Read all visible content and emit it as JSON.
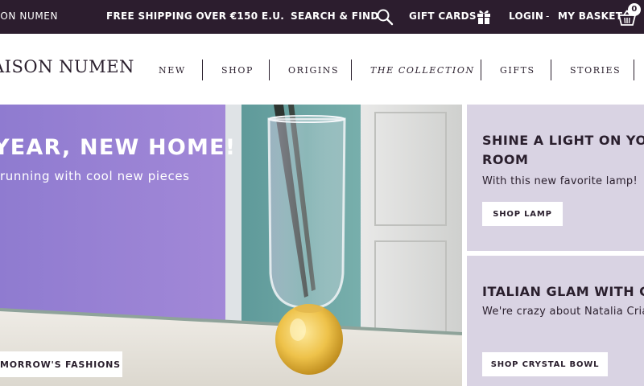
{
  "topbar": {
    "brand": "ISON NUMEN",
    "shipping": "FREE SHIPPING OVER €150 E.U.",
    "search_label": "SEARCH & FIND",
    "gift_cards_label": "GIFT CARDS",
    "login_label": "LOGIN",
    "separator": "-",
    "basket_label": "MY BASKET",
    "basket_count": "0",
    "icons": [
      "search-icon",
      "gift-icon",
      "basket-icon"
    ]
  },
  "nav": {
    "logo": "AISON NUMEN",
    "items": [
      {
        "label": "NEW",
        "italic": false
      },
      {
        "label": "SHOP",
        "italic": false
      },
      {
        "label": "ORIGINS",
        "italic": false
      },
      {
        "label": "THE COLLECTION",
        "italic": true
      },
      {
        "label": "GIFTS",
        "italic": false
      },
      {
        "label": "STORIES",
        "italic": false
      }
    ]
  },
  "hero": {
    "title": "YEAR, NEW HOME!",
    "subtitle": "running with cool new pieces",
    "button_label": "MORROW'S FASHIONS"
  },
  "cards": [
    {
      "title_line1": "SHINE A LIGHT ON YOUR",
      "title_line2": "ROOM",
      "subtitle": "With this new favorite lamp!",
      "button_label": "SHOP LAMP"
    },
    {
      "title_line1": "ITALIAN GLAM WITH CO",
      "subtitle": "We're crazy about Natalia Cria",
      "button_label": "SHOP CRYSTAL BOWL"
    }
  ],
  "colors": {
    "topbar_bg": "#2c1d2e",
    "hero_purple": "#9583cf",
    "card_bg": "#d9d3e3",
    "text_dark": "#2a1f2d"
  }
}
